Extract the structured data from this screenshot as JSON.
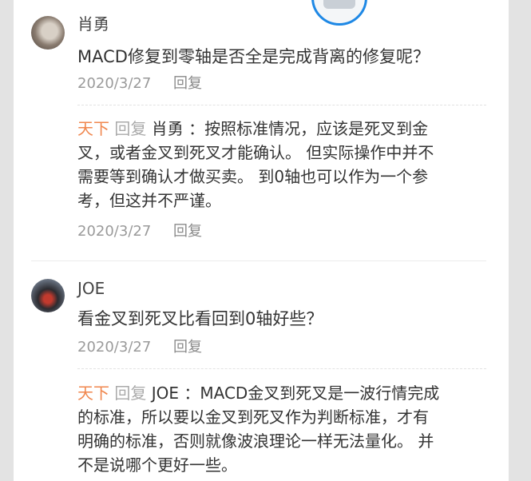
{
  "comments": [
    {
      "author": "肖勇",
      "text": "MACD修复到零轴是否全是完成背离的修复呢？",
      "date": "2020/3/27",
      "reply_label": "回复",
      "admin_reply": {
        "admin_name": "天下",
        "reply_word": "回复",
        "target": "肖勇 ：",
        "lines": [
          "按照标准情况，应该是死叉到金",
          "叉，或者金叉到死叉才能确认。 但实际操作中并不",
          "需要等到确认才做买卖。 到0轴也可以作为一个参",
          "考，但这并不严谨。"
        ],
        "date": "2020/3/27",
        "reply_label": "回复"
      }
    },
    {
      "author": "JOE",
      "text": "看金叉到死叉比看回到0轴好些？",
      "date": "2020/3/27",
      "reply_label": "回复",
      "admin_reply": {
        "admin_name": "天下",
        "reply_word": "回复",
        "target": "JOE ：",
        "lines": [
          "MACD金叉到死叉是一波行情完成",
          "的标准，所以要以金叉到死叉作为判断标准，才有",
          "明确的标准，否则就像波浪理论一样无法量化。 并",
          "不是说哪个更好一些。"
        ]
      }
    }
  ],
  "colors": {
    "admin_name": "#f0874e",
    "meta_gray": "#9a9a9a",
    "avatar_ring": "#1e88e5"
  }
}
